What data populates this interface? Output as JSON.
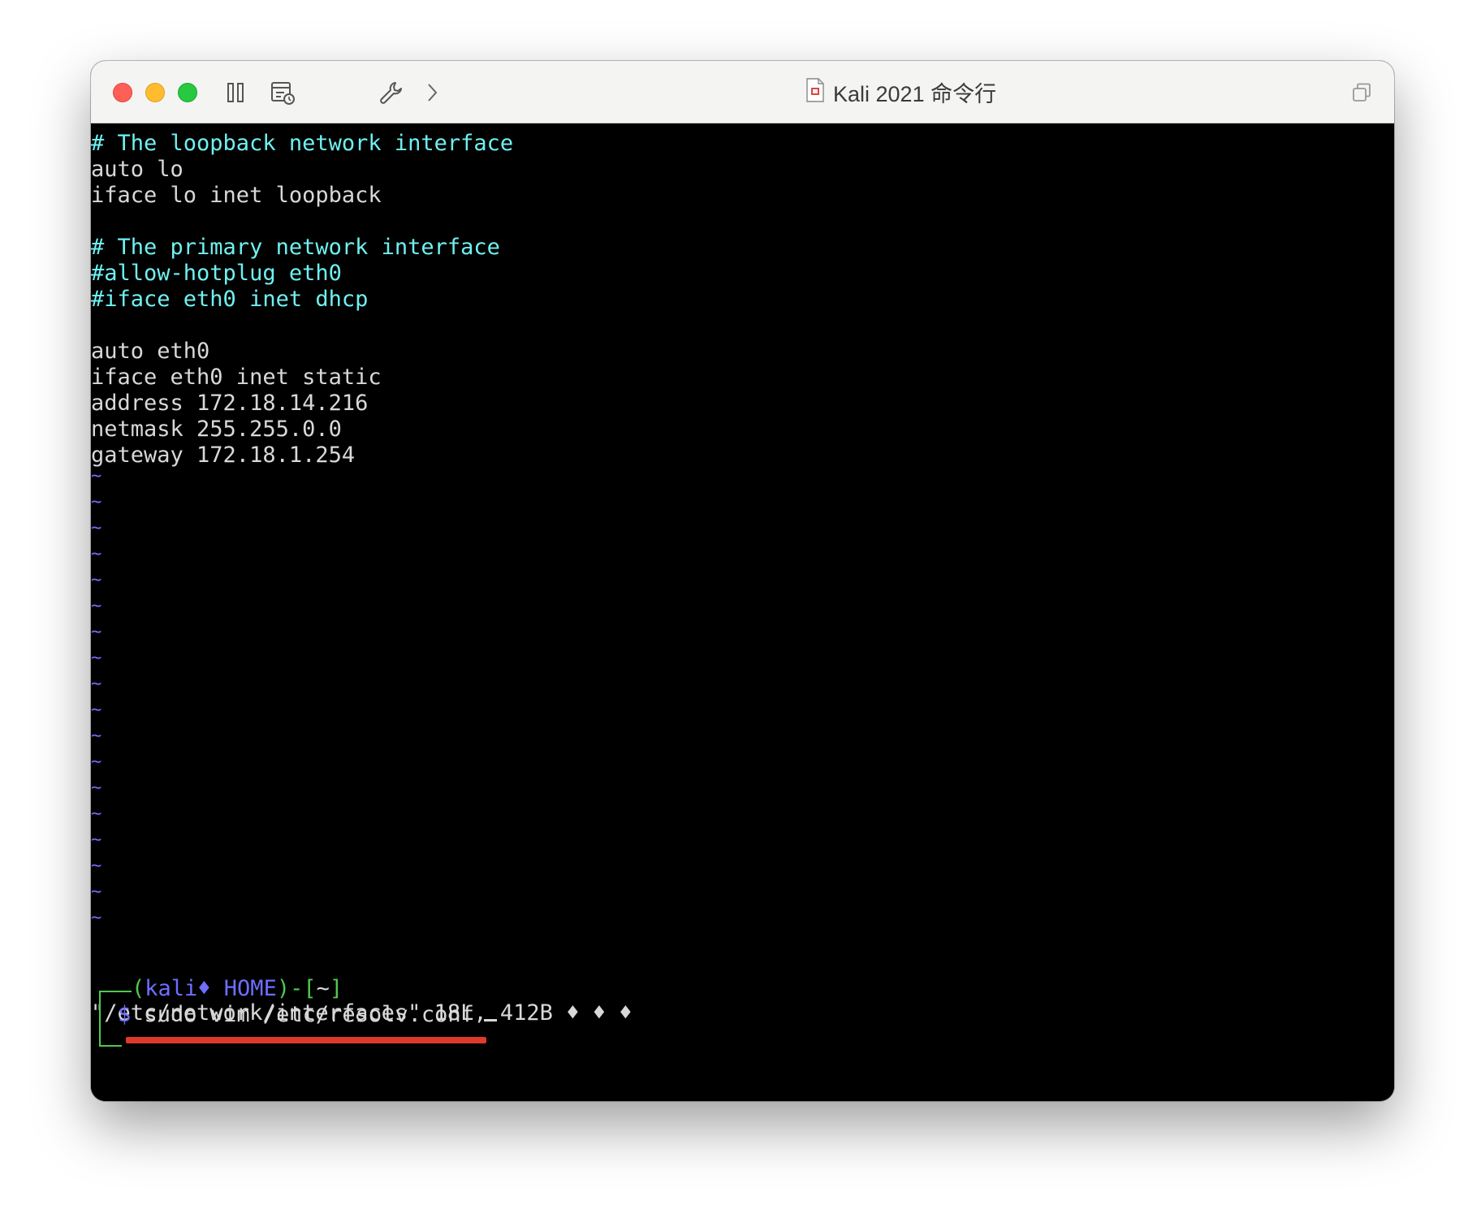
{
  "window": {
    "title": "Kali 2021 命令行"
  },
  "toolbar": {
    "icons": [
      "pause-icon",
      "snapshot-icon",
      "wrench-icon",
      "forward-chevron-icon",
      "restore-window-icon"
    ]
  },
  "terminal": {
    "file_lines": [
      {
        "text": "# The loopback network interface",
        "style": "comment"
      },
      {
        "text": "auto lo",
        "style": "normal"
      },
      {
        "text": "iface lo inet loopback",
        "style": "normal"
      },
      {
        "text": "",
        "style": "normal"
      },
      {
        "text": "# The primary network interface",
        "style": "comment"
      },
      {
        "text": "#allow-hotplug eth0",
        "style": "comment"
      },
      {
        "text": "#iface eth0 inet dhcp",
        "style": "comment"
      },
      {
        "text": "",
        "style": "normal"
      },
      {
        "text": "auto eth0",
        "style": "normal"
      },
      {
        "text": "iface eth0 inet static",
        "style": "normal"
      },
      {
        "text": "address 172.18.14.216",
        "style": "normal"
      },
      {
        "text": "netmask 255.255.0.0",
        "style": "normal"
      },
      {
        "text": "gateway 172.18.1.254",
        "style": "normal"
      }
    ],
    "tilde": "~",
    "tilde_count": 18,
    "status_line": "\"/etc/network/interfaces\" 18L, 412B ♦ ♦ ♦",
    "prompt": {
      "open": "(",
      "user": "kali♦ HOME",
      "close": ")-[",
      "dir": "~",
      "end": "]",
      "symbol": "$",
      "command": "sudo vim /etc/resolv.conf"
    }
  },
  "colors": {
    "comment": "#6ff0f0",
    "text": "#d8d8d8",
    "tilde": "#6e6eff",
    "prompt_green": "#4ec94e",
    "annotation_red": "#e03a2c"
  }
}
